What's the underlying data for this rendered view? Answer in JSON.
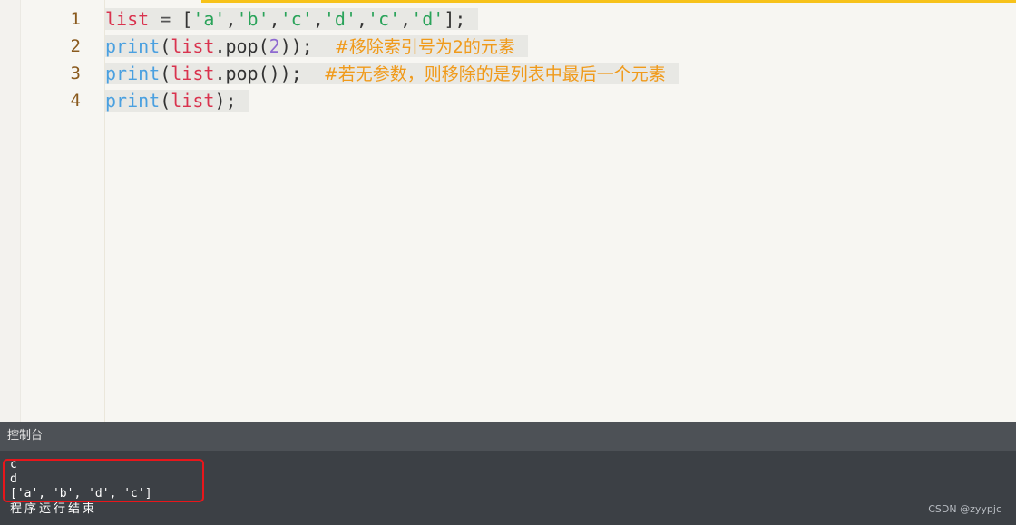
{
  "editor": {
    "line_numbers": [
      "1",
      "2",
      "3",
      "4"
    ],
    "lines": [
      {
        "tokens": [
          {
            "t": "list",
            "c": "var"
          },
          {
            "t": " = ",
            "c": "op"
          },
          {
            "t": "[",
            "c": "punc"
          },
          {
            "t": "'a'",
            "c": "str"
          },
          {
            "t": ",",
            "c": "punc"
          },
          {
            "t": "'b'",
            "c": "str"
          },
          {
            "t": ",",
            "c": "punc"
          },
          {
            "t": "'c'",
            "c": "str"
          },
          {
            "t": ",",
            "c": "punc"
          },
          {
            "t": "'d'",
            "c": "str"
          },
          {
            "t": ",",
            "c": "punc"
          },
          {
            "t": "'c'",
            "c": "str"
          },
          {
            "t": ",",
            "c": "punc"
          },
          {
            "t": "'d'",
            "c": "str"
          },
          {
            "t": "];",
            "c": "punc"
          }
        ]
      },
      {
        "tokens": [
          {
            "t": "print",
            "c": "fn"
          },
          {
            "t": "(",
            "c": "punc"
          },
          {
            "t": "list",
            "c": "var"
          },
          {
            "t": ".pop(",
            "c": "punc"
          },
          {
            "t": "2",
            "c": "num"
          },
          {
            "t": "));  ",
            "c": "punc"
          },
          {
            "t": "#移除索引号为2的元素",
            "c": "cmt"
          }
        ]
      },
      {
        "tokens": [
          {
            "t": "print",
            "c": "fn"
          },
          {
            "t": "(",
            "c": "punc"
          },
          {
            "t": "list",
            "c": "var"
          },
          {
            "t": ".pop());  ",
            "c": "punc"
          },
          {
            "t": "#若无参数，则移除的是列表中最后一个元素",
            "c": "cmt"
          }
        ]
      },
      {
        "tokens": [
          {
            "t": "print",
            "c": "fn"
          },
          {
            "t": "(",
            "c": "punc"
          },
          {
            "t": "list",
            "c": "var"
          },
          {
            "t": ");",
            "c": "punc"
          }
        ]
      }
    ]
  },
  "console": {
    "title": "控制台",
    "output_lines": [
      "c",
      "d",
      "['a', 'b', 'd', 'c']"
    ],
    "finish_message": "程序运行结束",
    "watermark": "CSDN @zyypjc"
  },
  "colors": {
    "accent_top": "#f7c21a",
    "highlight_box": "#e8161b",
    "keyword_var": "#d9334e",
    "keyword_fn": "#4aa0e0",
    "string": "#2aa35a",
    "number": "#8e6ad0",
    "comment": "#f09a1a",
    "console_bg": "#3c4045"
  }
}
